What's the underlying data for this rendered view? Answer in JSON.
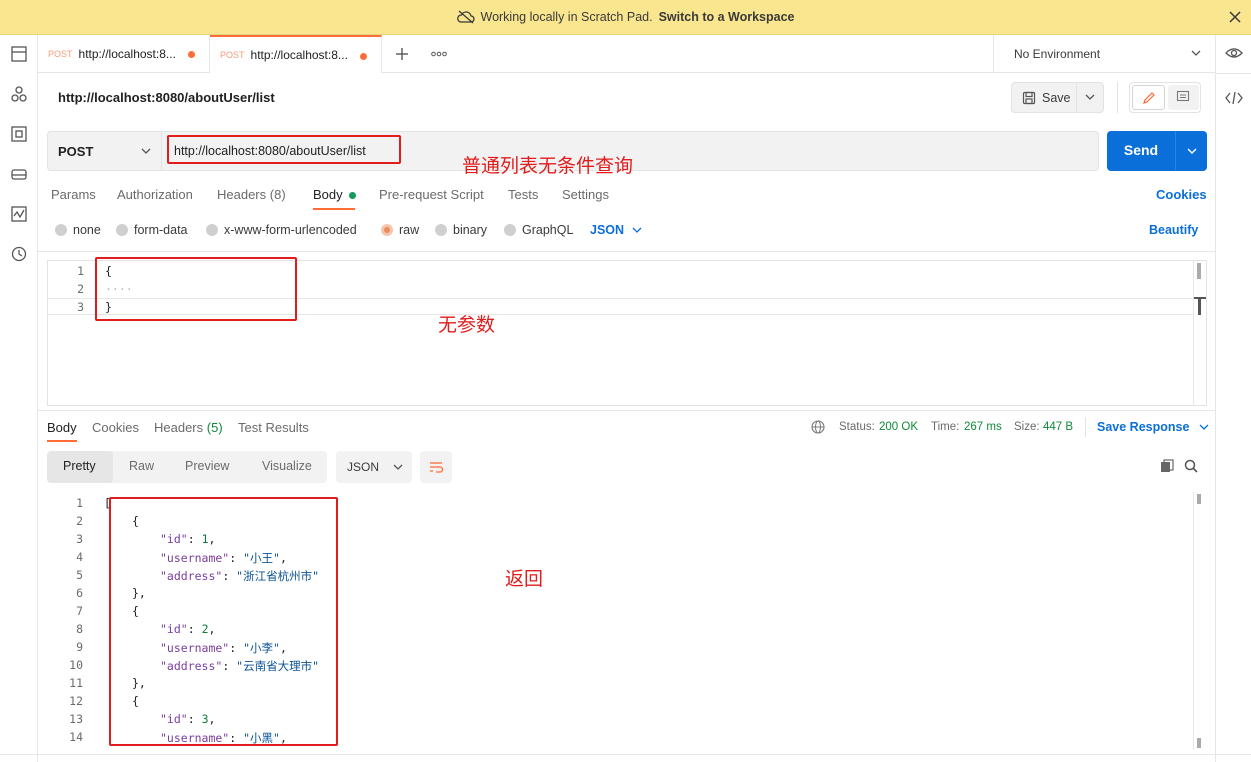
{
  "banner": {
    "text": "Working locally in Scratch Pad.",
    "link": "Switch to a Workspace"
  },
  "sidebar_left": [
    "collections-icon",
    "apis-icon",
    "environments-icon",
    "mock-servers-icon",
    "monitors-icon",
    "history-icon"
  ],
  "tabs": [
    {
      "method": "POST",
      "title": "http://localhost:8..."
    },
    {
      "method": "POST",
      "title": "http://localhost:8..."
    }
  ],
  "environment": "No Environment",
  "request": {
    "title": "http://localhost:8080/aboutUser/list",
    "save_label": "Save",
    "method": "POST",
    "url": "http://localhost:8080/aboutUser/list",
    "send_label": "Send"
  },
  "request_tabs": {
    "params": "Params",
    "authorization": "Authorization",
    "headers": "Headers",
    "headers_count": "(8)",
    "body": "Body",
    "pre_request": "Pre-request Script",
    "tests": "Tests",
    "settings": "Settings",
    "cookies": "Cookies"
  },
  "body_types": {
    "none": "none",
    "form_data": "form-data",
    "urlencoded": "x-www-form-urlencoded",
    "raw": "raw",
    "binary": "binary",
    "graphql": "GraphQL",
    "format": "JSON",
    "beautify": "Beautify"
  },
  "request_body": {
    "line1": "{",
    "line2": "····",
    "line3": "}"
  },
  "annotations": {
    "url_note": "普通列表无条件查询",
    "params_note": "无参数",
    "return_note": "返回"
  },
  "response_tabs": {
    "body": "Body",
    "cookies": "Cookies",
    "headers": "Headers",
    "headers_count": "(5)",
    "test_results": "Test Results"
  },
  "response_status": {
    "status_label": "Status:",
    "status_value": "200 OK",
    "time_label": "Time:",
    "time_value": "267 ms",
    "size_label": "Size:",
    "size_value": "447 B",
    "save_response": "Save Response"
  },
  "response_view": {
    "pretty": "Pretty",
    "raw": "Raw",
    "preview": "Preview",
    "visualize": "Visualize",
    "format": "JSON"
  },
  "response_body": {
    "l1": "[",
    "l2": "{",
    "l3_key": "\"id\"",
    "l3_val": "1",
    "l4_key": "\"username\"",
    "l4_val": "\"小王\"",
    "l5_key": "\"address\"",
    "l5_val": "\"浙江省杭州市\"",
    "l6": "},",
    "l7": "{",
    "l8_key": "\"id\"",
    "l8_val": "2",
    "l9_key": "\"username\"",
    "l9_val": "\"小李\"",
    "l10_key": "\"address\"",
    "l10_val": "\"云南省大理市\"",
    "l11": "},",
    "l12": "{",
    "l13_key": "\"id\"",
    "l13_val": "3",
    "l14_key": "\"username\"",
    "l14_val": "\"小黑\""
  },
  "colors": {
    "accent": "#ff6c37",
    "primary": "#0a6fd8",
    "annotation": "#e11c1c",
    "banner": "#f9e68f"
  }
}
